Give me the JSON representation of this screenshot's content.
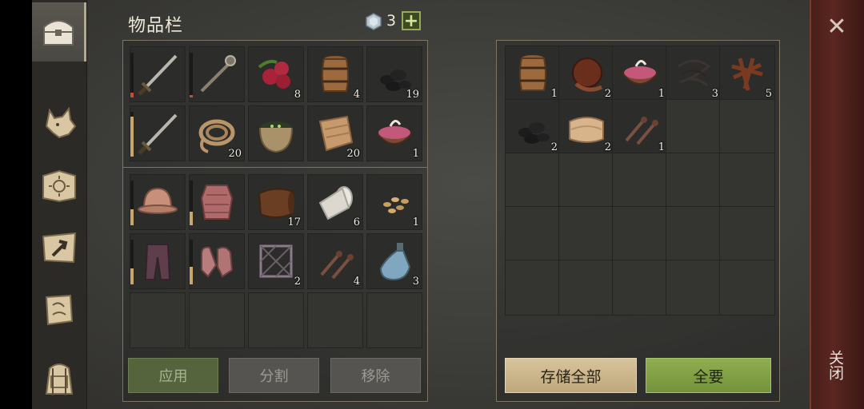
{
  "inventory": {
    "title": "物品栏",
    "gem_count": "3",
    "plus_label": "+",
    "buttons": {
      "apply": "应用",
      "split": "分割",
      "remove": "移除"
    },
    "rows": [
      [
        {
          "icon": "sword-icon",
          "count": "",
          "durability": 0.1,
          "durability_color": "#c94a3a"
        },
        {
          "icon": "spiked-mace-icon",
          "count": "",
          "durability": 0.05,
          "durability_color": "#c94a3a"
        },
        {
          "icon": "berries-icon",
          "count": "8"
        },
        {
          "icon": "barrel-icon",
          "count": "4"
        },
        {
          "icon": "coal-icon",
          "count": "19"
        }
      ],
      [
        {
          "icon": "sword-icon",
          "count": "",
          "durability": 0.9,
          "durability_color": "#c9a66a"
        },
        {
          "icon": "rope-icon",
          "count": "20"
        },
        {
          "icon": "basket-icon",
          "count": ""
        },
        {
          "icon": "cloth-icon",
          "count": "20"
        },
        {
          "icon": "meat-bowl-icon",
          "count": "1"
        }
      ],
      [
        {
          "icon": "helmet-icon",
          "count": "",
          "durability": 0.35,
          "durability_color": "#c9a66a"
        },
        {
          "icon": "chainmail-icon",
          "count": "",
          "durability": 0.3,
          "durability_color": "#c9a66a"
        },
        {
          "icon": "leather-icon",
          "count": "17"
        },
        {
          "icon": "bandage-icon",
          "count": "6"
        },
        {
          "icon": "seeds-icon",
          "count": "1"
        }
      ],
      [
        {
          "icon": "pants-icon",
          "count": "",
          "durability": 0.35,
          "durability_color": "#c9a66a"
        },
        {
          "icon": "gloves-icon",
          "count": "",
          "durability": 0.4,
          "durability_color": "#c9a66a"
        },
        {
          "icon": "frame-icon",
          "count": "2"
        },
        {
          "icon": "nails-icon",
          "count": "4"
        },
        {
          "icon": "bottle-icon",
          "count": "3"
        }
      ]
    ]
  },
  "storage": {
    "buttons": {
      "store_all": "存储全部",
      "take_all": "全要"
    },
    "items": [
      {
        "icon": "barrel-icon",
        "count": "1"
      },
      {
        "icon": "water-flask-icon",
        "count": "2"
      },
      {
        "icon": "meat-bowl-icon",
        "count": "1"
      },
      {
        "icon": "thread-icon",
        "count": "3"
      },
      {
        "icon": "leather-strips-icon",
        "count": "5"
      },
      {
        "icon": "coal-icon",
        "count": "2"
      },
      {
        "icon": "cloth-roll-icon",
        "count": "2"
      },
      {
        "icon": "nails-icon",
        "count": "1"
      }
    ]
  },
  "sidebar": {
    "tabs": [
      "chest-icon",
      "wolf-icon",
      "sun-book-icon",
      "map-arrow-icon",
      "quest-scroll-icon",
      "backpack-icon"
    ]
  },
  "close": {
    "x": "✕",
    "label": "关闭"
  }
}
